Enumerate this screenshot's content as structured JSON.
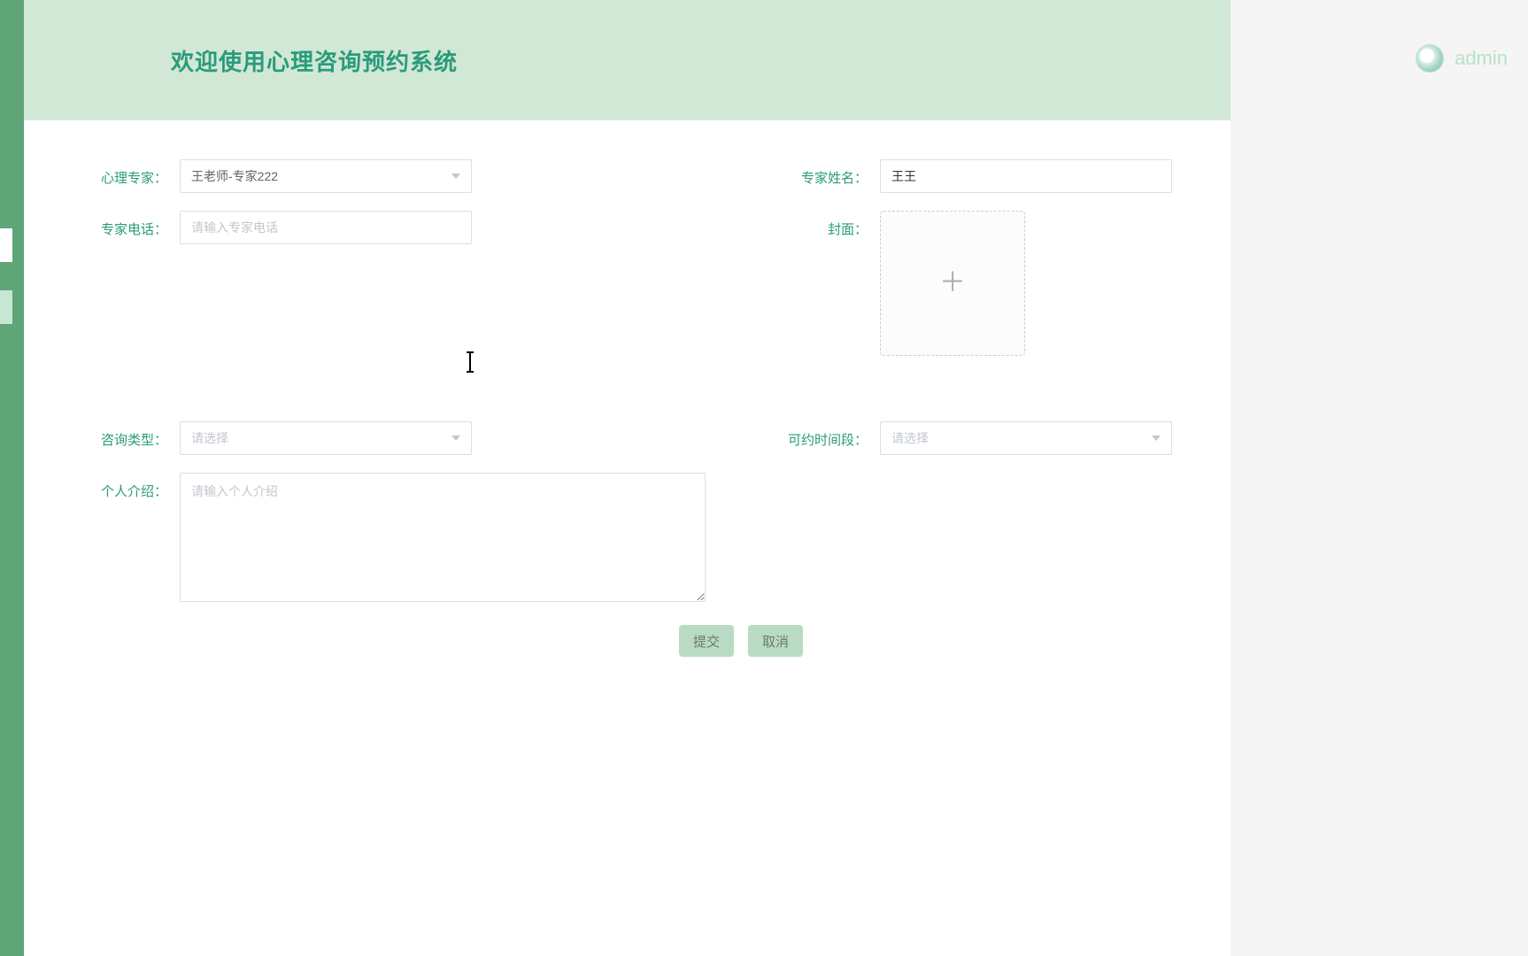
{
  "header": {
    "title": "欢迎使用心理咨询预约系统"
  },
  "user": {
    "name": "admin"
  },
  "form": {
    "expert_label": "心理专家：",
    "expert_value": "王老师-专家222",
    "name_label": "专家姓名：",
    "name_value": "王王",
    "phone_label": "专家电话：",
    "phone_placeholder": "请输入专家电话",
    "cover_label": "封面：",
    "type_label": "咨询类型：",
    "type_placeholder": "请选择",
    "slot_label": "可约时间段：",
    "slot_placeholder": "请选择",
    "intro_label": "个人介绍：",
    "intro_placeholder": "请输入个人介绍"
  },
  "buttons": {
    "submit": "提交",
    "cancel": "取消"
  }
}
